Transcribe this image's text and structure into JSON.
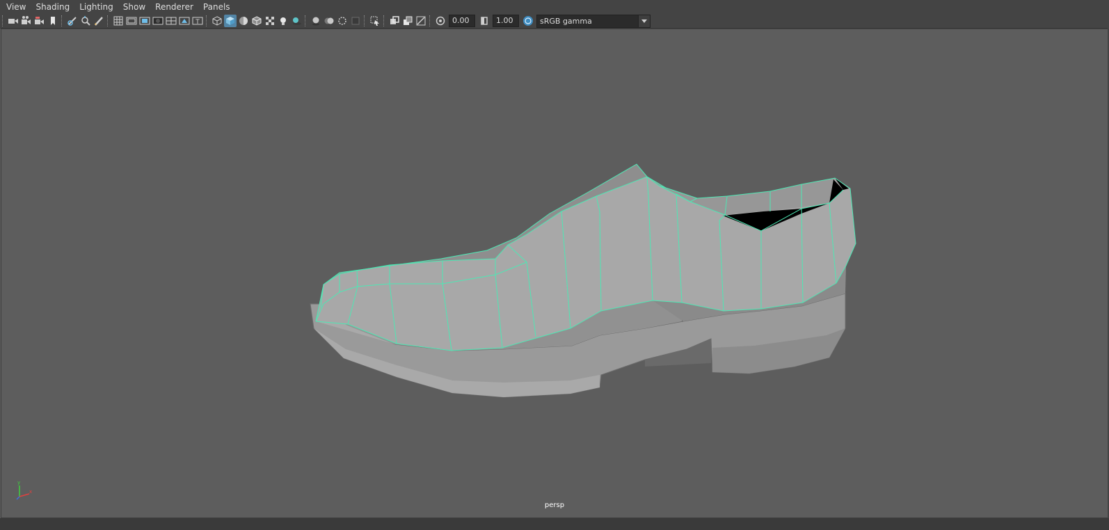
{
  "menubar": {
    "items": [
      "View",
      "Shading",
      "Lighting",
      "Show",
      "Renderer",
      "Panels"
    ]
  },
  "toolbar": {
    "exposure_value": "0.00",
    "gamma_value": "1.00",
    "color_space": "sRGB gamma",
    "icons": [
      "select-camera-icon",
      "camera-attributes-icon",
      "bookmark-icon",
      "image-plane-icon",
      "grease-pencil-icon",
      "2d-pan-zoom-icon",
      "grid-icon",
      "film-gate-icon",
      "resolution-gate-icon",
      "gate-mask-icon",
      "field-chart-icon",
      "safe-action-icon",
      "safe-title-icon",
      "wireframe-icon",
      "smooth-shade-icon",
      "default-material-icon",
      "wireframe-on-shaded-icon",
      "textured-icon",
      "use-all-lights-icon",
      "shadows-icon",
      "screen-space-ambient-occlusion-icon",
      "motion-blur-icon",
      "multisample-antialiasing-icon",
      "depth-of-field-icon",
      "isolate-select-icon",
      "xray-icon",
      "xray-active-components-icon",
      "xray-joints-icon",
      "exposure-icon",
      "gamma-icon",
      "view-transform-icon"
    ]
  },
  "viewport": {
    "camera": "persp",
    "wire_color": "#4de8b4",
    "background": "#5d5d5d"
  }
}
